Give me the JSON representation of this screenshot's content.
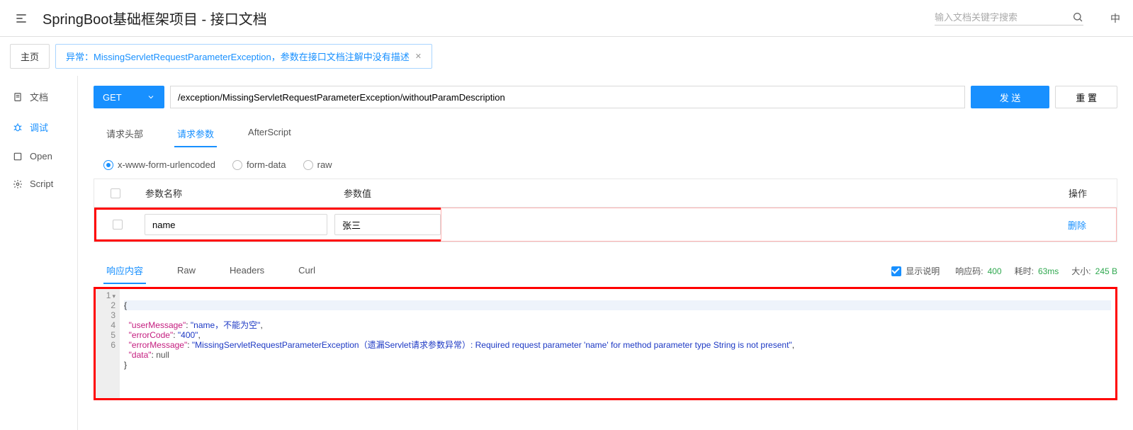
{
  "header": {
    "title": "SpringBoot基础框架项目 - 接口文档",
    "search_placeholder": "输入文档关键字搜索",
    "lang": "中"
  },
  "tabs": {
    "home": "主页",
    "active": "异常：MissingServletRequestParameterException，参数在接口文档注解中没有描述"
  },
  "sidebar": {
    "items": [
      {
        "label": "文档"
      },
      {
        "label": "调试"
      },
      {
        "label": "Open"
      },
      {
        "label": "Script"
      }
    ]
  },
  "request": {
    "method": "GET",
    "url": "/exception/MissingServletRequestParameterException/withoutParamDescription",
    "send": "发 送",
    "reset": "重 置",
    "subtabs": {
      "headers": "请求头部",
      "params": "请求参数",
      "after": "AfterScript"
    },
    "encodings": {
      "form": "x-www-form-urlencoded",
      "multipart": "form-data",
      "raw": "raw"
    },
    "param_table": {
      "name_header": "参数名称",
      "value_header": "参数值",
      "op_header": "操作",
      "rows": [
        {
          "name": "name",
          "value": "张三",
          "op": "删除"
        }
      ]
    }
  },
  "response": {
    "tabs": {
      "body": "响应内容",
      "raw": "Raw",
      "headers": "Headers",
      "curl": "Curl"
    },
    "show_desc_label": "显示说明",
    "status_label": "响应码:",
    "status": "400",
    "time_label": "耗时:",
    "time": "63ms",
    "size_label": "大小:",
    "size": "245 B",
    "json": {
      "userMessage_key": "\"userMessage\"",
      "userMessage_val": "\"name，不能为空\"",
      "errorCode_key": "\"errorCode\"",
      "errorCode_val": "\"400\"",
      "errorMessage_key": "\"errorMessage\"",
      "errorMessage_val": "\"MissingServletRequestParameterException（遗漏Servlet请求参数异常）: Required request parameter 'name' for method parameter type String is not present\"",
      "data_key": "\"data\"",
      "data_val": "null"
    }
  }
}
